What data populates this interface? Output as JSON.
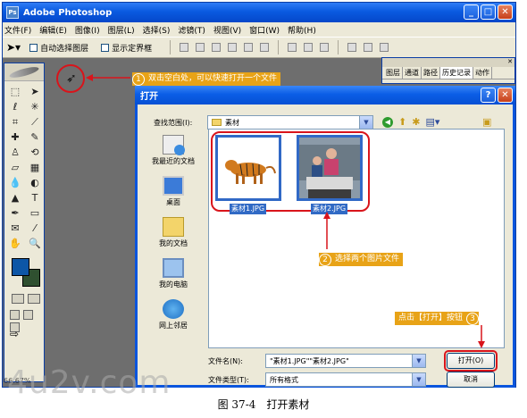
{
  "ps": {
    "title": "Adobe Photoshop",
    "menus": [
      "文件(F)",
      "编辑(E)",
      "图像(I)",
      "图层(L)",
      "选择(S)",
      "滤镜(T)",
      "视图(V)",
      "窗口(W)",
      "帮助(H)"
    ],
    "options": {
      "auto_select": "自动选择图层",
      "show_bounds": "显示定界框"
    },
    "history_tabs": [
      "图层",
      "通道",
      "路径",
      "历史记录",
      "动作"
    ],
    "zoom": "66.67%"
  },
  "annotations": {
    "step1": {
      "num": "1",
      "text": "双击空白处，可以快速打开一个文件"
    },
    "step2": {
      "num": "2",
      "text": "选择两个图片文件"
    },
    "step3": {
      "num": "3",
      "text": "点击【打开】按钮"
    },
    "accent": "#e8a317",
    "highlight": "#d9141b"
  },
  "dialog": {
    "title": "打开",
    "look_in_label": "查找范围(I):",
    "look_in_value": "素材",
    "places": [
      "我最近的文档",
      "桌面",
      "我的文档",
      "我的电脑",
      "网上邻居"
    ],
    "files": [
      {
        "name": "素材1.JPG",
        "thumb": "tiger"
      },
      {
        "name": "素材2.JPG",
        "thumb": "people-photo"
      }
    ],
    "filename_label": "文件名(N):",
    "filename_value": "\"素材1.JPG\"\"素材2.JPG\"",
    "filetype_label": "文件类型(T):",
    "filetype_value": "所有格式",
    "open_button": "打开(O)",
    "cancel_button": "取消",
    "help_button": "?",
    "close_button": "✕"
  },
  "caption": "图 37-4　打开素材",
  "watermark": "4u2v.com"
}
